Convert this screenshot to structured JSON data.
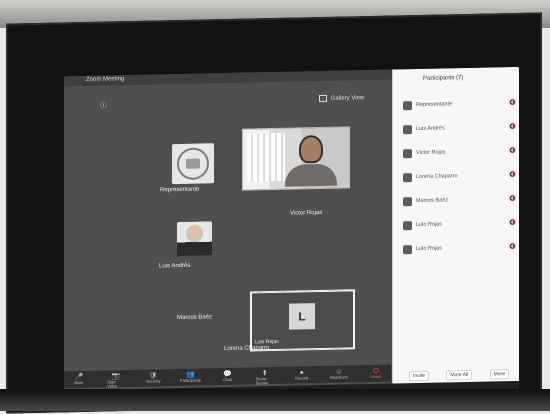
{
  "window": {
    "title": "Zoom Meeting",
    "gallery_view": "Gallery View"
  },
  "meeting": {
    "tile_1_name": "Representante",
    "video_name": "Victor Rojas",
    "tile_2_name": "Luis Andrés",
    "tile_3_name": "Marcos Baéz",
    "selected_name": "Lulo Rojas",
    "tile_4_name": "Lorena Chaparro",
    "selected_avatar_letter": "L"
  },
  "participants": {
    "title": "Participants (7)",
    "items": [
      {
        "name": "Representante",
        "icons": "🔇"
      },
      {
        "name": "Luis Andrés",
        "icons": "🔇"
      },
      {
        "name": "Victor Rojas",
        "icons": "🔇"
      },
      {
        "name": "Lorena Chaparro",
        "icons": "🔇"
      },
      {
        "name": "Marcos Baéz",
        "icons": "🔇"
      },
      {
        "name": "Lulo Rojas",
        "icons": "🔇"
      },
      {
        "name": "Lulo Rojas",
        "icons": "🔇"
      }
    ],
    "footer": {
      "invite": "Invite",
      "mute_all": "Mute All",
      "more": "More"
    }
  },
  "toolbar": {
    "mute": "Mute",
    "start_video": "Start Video",
    "security": "Security",
    "participants": "Participants",
    "chat": "Chat",
    "share_screen": "Share Screen",
    "record": "Record",
    "reactions": "Reactions",
    "leave": "Leave"
  }
}
